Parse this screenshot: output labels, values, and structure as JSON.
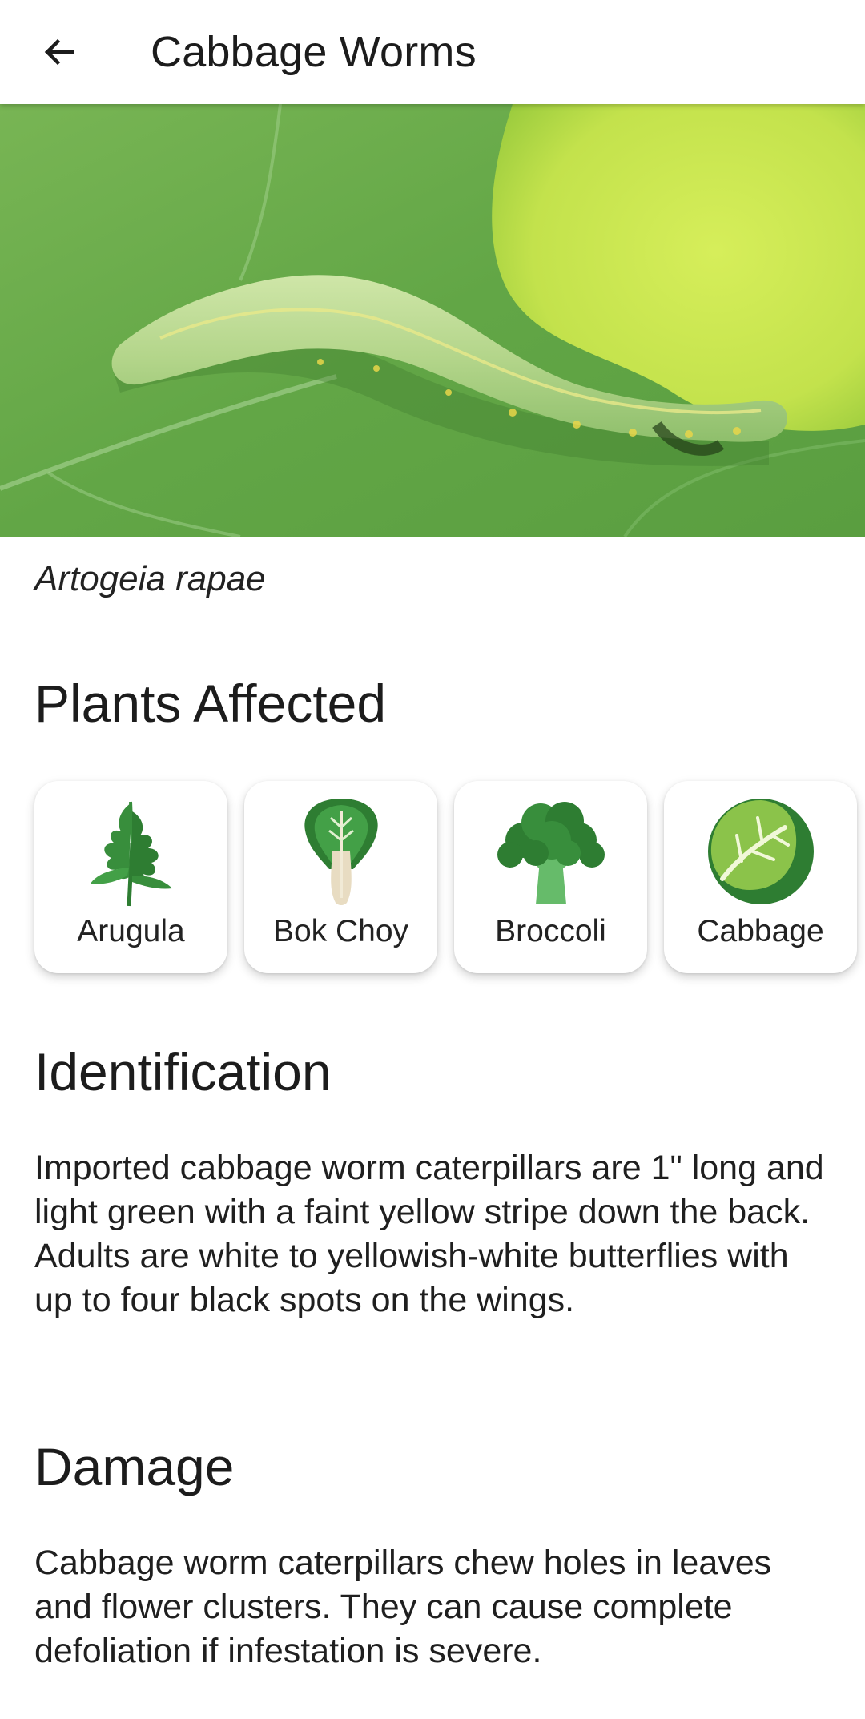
{
  "app_bar": {
    "title": "Cabbage Worms",
    "back_icon": "arrow-back-icon"
  },
  "hero": {
    "subject": "caterpillar-on-leaf"
  },
  "scientific_name": "Artogeia rapae",
  "plants_affected": {
    "title": "Plants Affected",
    "items": [
      {
        "label": "Arugula",
        "icon": "arugula-icon"
      },
      {
        "label": "Bok Choy",
        "icon": "bok-choy-icon"
      },
      {
        "label": "Broccoli",
        "icon": "broccoli-icon"
      },
      {
        "label": "Cabbage",
        "icon": "cabbage-icon"
      }
    ]
  },
  "identification": {
    "title": "Identification",
    "text": "Imported cabbage worm caterpillars are 1\" long and light green with a faint yellow stripe down the back. Adults are white to yellowish-white butterflies with up to four black spots on the wings."
  },
  "damage": {
    "title": "Damage",
    "text": "Cabbage worm caterpillars chew holes in leaves and flower clusters. They can cause complete defoliation if infestation is severe."
  },
  "colors": {
    "leaf_green": "#6cae4a",
    "lime": "#c9e650",
    "caterpillar": "#b8d88a",
    "text": "#1c1c1c"
  }
}
